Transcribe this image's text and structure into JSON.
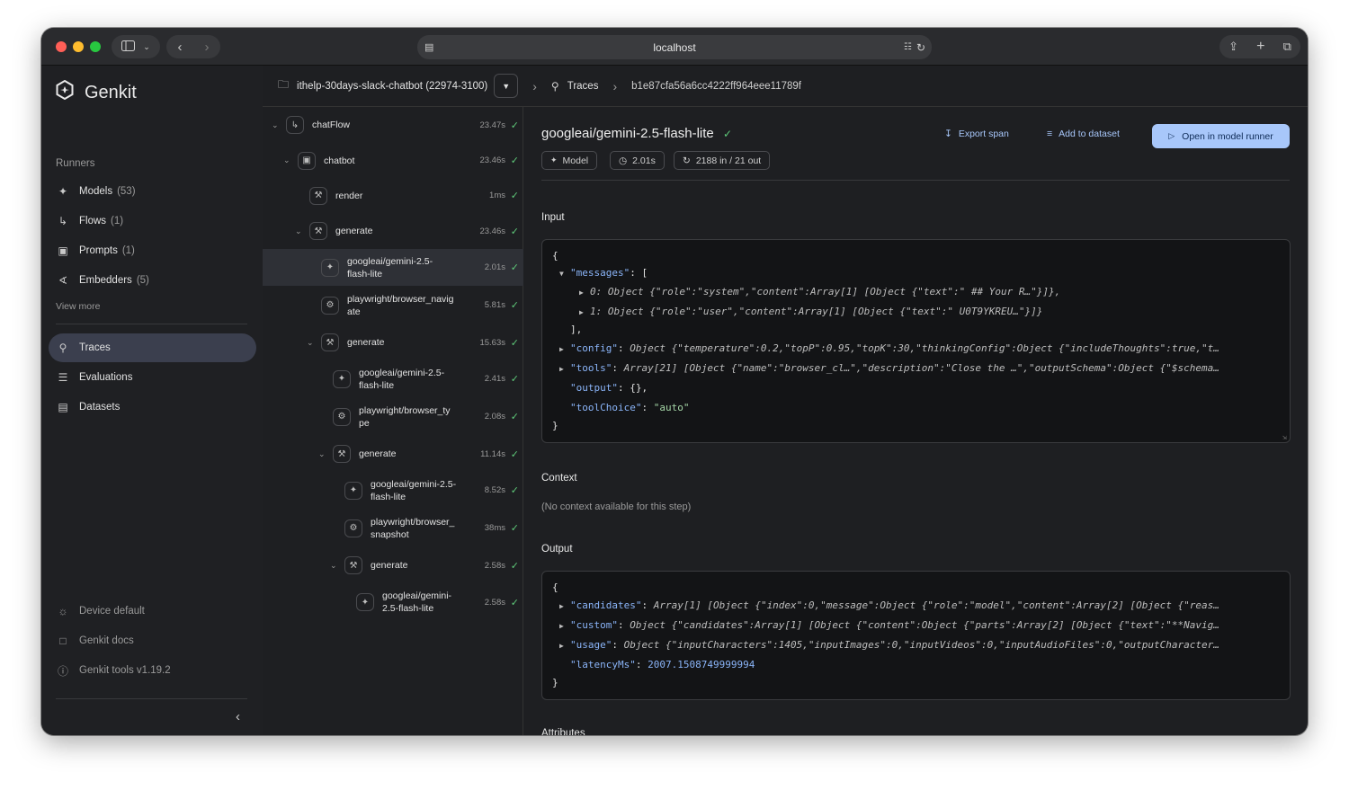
{
  "browser": {
    "url": "localhost"
  },
  "app": {
    "name": "Genkit"
  },
  "sidebar": {
    "section_label": "Runners",
    "runners": [
      {
        "label": "Models",
        "count": "(53)",
        "icon": "sparkle-icon"
      },
      {
        "label": "Flows",
        "count": "(1)",
        "icon": "flow-icon"
      },
      {
        "label": "Prompts",
        "count": "(1)",
        "icon": "prompt-icon"
      },
      {
        "label": "Embedders",
        "count": "(5)",
        "icon": "embedder-icon"
      }
    ],
    "view_more": "View more",
    "nav": [
      {
        "label": "Traces",
        "icon": "traces-icon",
        "active": true
      },
      {
        "label": "Evaluations",
        "icon": "evaluations-icon",
        "active": false
      },
      {
        "label": "Datasets",
        "icon": "datasets-icon",
        "active": false
      }
    ],
    "footer": [
      {
        "label": "Device default",
        "icon": "brightness-icon"
      },
      {
        "label": "Genkit docs",
        "icon": "doc-icon"
      },
      {
        "label": "Genkit tools v1.19.2",
        "icon": "info-icon"
      }
    ]
  },
  "breadcrumb": {
    "project": "ithelp-30days-slack-chatbot (22974-3100)",
    "traces": "Traces",
    "trace_id": "b1e87cfa56a6cc4222ff964eee11789f"
  },
  "tree": [
    {
      "label1": "chatFlow",
      "label2": "",
      "duration": "23.47s",
      "icon": "flow-icon"
    },
    {
      "label1": "chatbot",
      "label2": "",
      "duration": "23.46s",
      "icon": "prompt-icon"
    },
    {
      "label1": "render",
      "label2": "",
      "duration": "1ms",
      "icon": "tool-icon"
    },
    {
      "label1": "generate",
      "label2": "",
      "duration": "23.46s",
      "icon": "tool-icon"
    },
    {
      "label1": "googleai/gemini-2.5-",
      "label2": "flash-lite",
      "duration": "2.01s",
      "icon": "sparkle-icon",
      "selected": true
    },
    {
      "label1": "playwright/browser_navig",
      "label2": "ate",
      "duration": "5.81s",
      "icon": "wrench-icon"
    },
    {
      "label1": "generate",
      "label2": "",
      "duration": "15.63s",
      "icon": "tool-icon"
    },
    {
      "label1": "googleai/gemini-2.5-",
      "label2": "flash-lite",
      "duration": "2.41s",
      "icon": "sparkle-icon"
    },
    {
      "label1": "playwright/browser_ty",
      "label2": "pe",
      "duration": "2.08s",
      "icon": "wrench-icon"
    },
    {
      "label1": "generate",
      "label2": "",
      "duration": "11.14s",
      "icon": "tool-icon"
    },
    {
      "label1": "googleai/gemini-2.5-",
      "label2": "flash-lite",
      "duration": "8.52s",
      "icon": "sparkle-icon"
    },
    {
      "label1": "playwright/browser_",
      "label2": "snapshot",
      "duration": "38ms",
      "icon": "wrench-icon"
    },
    {
      "label1": "generate",
      "label2": "",
      "duration": "2.58s",
      "icon": "tool-icon"
    },
    {
      "label1": "googleai/gemini-",
      "label2": "2.5-flash-lite",
      "duration": "2.58s",
      "icon": "sparkle-icon"
    }
  ],
  "detail": {
    "title": "googleai/gemini-2.5-flash-lite",
    "chips": {
      "type": "Model",
      "duration": "2.01s",
      "tokens": "2188 in / 21 out"
    },
    "actions": {
      "export": "Export span",
      "add_dataset": "Add to dataset",
      "open_runner": "Open in model runner"
    },
    "input_label": "Input",
    "input_lines": {
      "l0": "{",
      "messages_key": "\"messages\"",
      "messages_rest": ": [",
      "m0_idx": "0:",
      "m0_val": "Object {\"role\":\"system\",\"content\":Array[1] [Object {\"text\":\" ## Your R…\"}]},",
      "m1_idx": "1:",
      "m1_val": "Object {\"role\":\"user\",\"content\":Array[1] [Object {\"text\":\" U0T9YKREU…\"}]}",
      "close_arr": "],",
      "config_key": "\"config\"",
      "config_val": "Object {\"temperature\":0.2,\"topP\":0.95,\"topK\":30,\"thinkingConfig\":Object {\"includeThoughts\":true,\"t…",
      "tools_key": "\"tools\"",
      "tools_val": "Array[21] [Object {\"name\":\"browser_cl…\",\"description\":\"Close the …\",\"outputSchema\":Object {\"$schema…",
      "output_key": "\"output\"",
      "output_val": ": {},",
      "toolchoice_key": "\"toolChoice\"",
      "toolchoice_val": "\"auto\"",
      "lend": "}"
    },
    "context_label": "Context",
    "context_text": "(No context available for this step)",
    "output_label": "Output",
    "output_lines": {
      "l0": "{",
      "cand_key": "\"candidates\"",
      "cand_val": "Array[1] [Object {\"index\":0,\"message\":Object {\"role\":\"model\",\"content\":Array[2] [Object {\"reas…",
      "custom_key": "\"custom\"",
      "custom_val": "Object {\"candidates\":Array[1] [Object {\"content\":Object {\"parts\":Array[2] [Object {\"text\":\"**Navig…",
      "usage_key": "\"usage\"",
      "usage_val": "Object {\"inputCharacters\":1405,\"inputImages\":0,\"inputVideos\":0,\"inputAudioFiles\":0,\"outputCharacter…",
      "lat_key": "\"latencyMs\"",
      "lat_val": "2007.1508749999994",
      "lend": "}"
    },
    "attributes_label": "Attributes"
  }
}
